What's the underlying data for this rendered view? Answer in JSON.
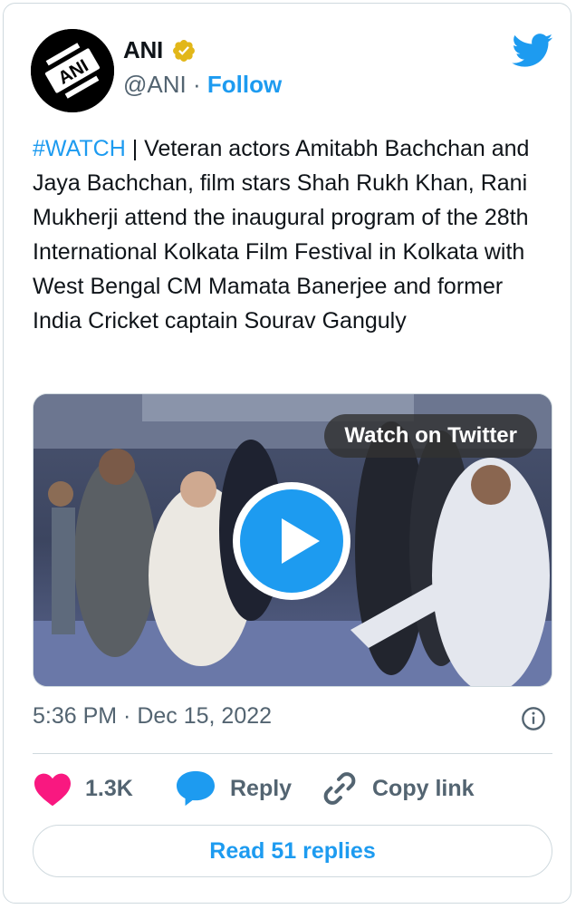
{
  "author": {
    "name": "ANI",
    "handle": "@ANI",
    "separator": "·",
    "follow_label": "Follow",
    "avatar_text": "ANI",
    "verified_icon": "verified-badge-icon"
  },
  "tweet": {
    "hashtag": "#WATCH",
    "body": " | Veteran actors Amitabh Bachchan and Jaya Bachchan, film stars Shah Rukh Khan, Rani Mukherji attend the inaugural program of the 28th International Kolkata Film Festival in Kolkata with West Bengal CM Mamata Banerjee and former India Cricket captain Sourav Ganguly"
  },
  "media": {
    "watch_label": "Watch on Twitter",
    "play_icon": "play-icon"
  },
  "meta": {
    "timestamp": "5:36 PM · Dec 15, 2022"
  },
  "actions": {
    "likes": "1.3K",
    "reply_label": "Reply",
    "copy_label": "Copy link"
  },
  "read_replies": "Read 51 replies",
  "colors": {
    "accent": "#1d9bf0",
    "like": "#f91880",
    "muted": "#536471",
    "border": "#cfd9de"
  }
}
